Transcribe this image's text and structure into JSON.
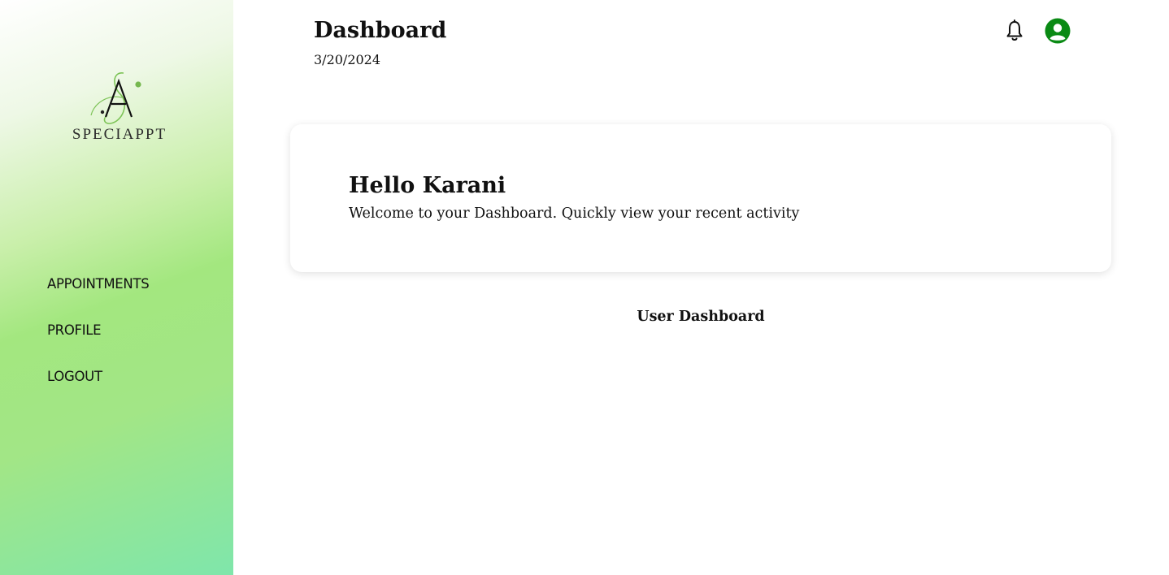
{
  "brand": {
    "logo_text": "SPECIAPPT",
    "accent_color": "#76c752"
  },
  "sidebar": {
    "items": [
      {
        "label": "APPOINTMENTS"
      },
      {
        "label": "PROFILE"
      },
      {
        "label": "LOGOUT"
      }
    ]
  },
  "header": {
    "title": "Dashboard",
    "date": "3/20/2024",
    "icons": [
      "bell-icon",
      "user-avatar-icon"
    ],
    "avatar_color": "#0a8a14"
  },
  "welcome_card": {
    "title": "Hello Karani",
    "subtitle": "Welcome to your Dashboard. Quickly view your recent activity"
  },
  "main": {
    "section_label": "User Dashboard"
  }
}
